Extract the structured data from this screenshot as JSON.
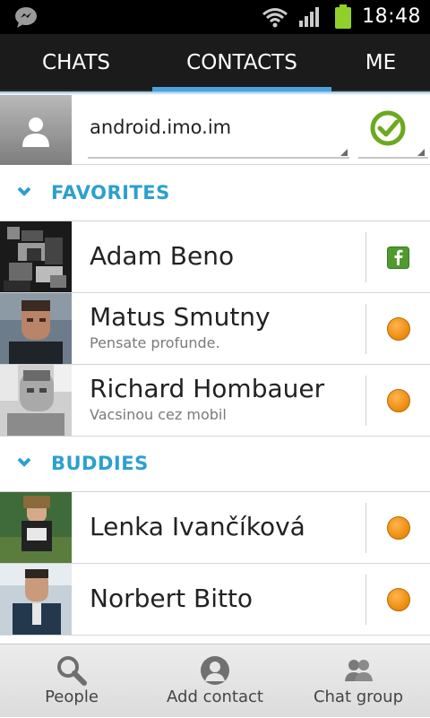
{
  "status_bar": {
    "time": "18:48",
    "icons": [
      "messenger-icon",
      "wifi-icon",
      "signal-icon",
      "battery-icon"
    ]
  },
  "tabs": [
    {
      "label": "CHATS",
      "selected": false
    },
    {
      "label": "CONTACTS",
      "selected": true
    },
    {
      "label": "ME",
      "selected": false
    }
  ],
  "account": {
    "name": "android.imo.im",
    "status": "online"
  },
  "sections": {
    "favorites": "FAVORITES",
    "buddies": "BUDDIES"
  },
  "favorites": [
    {
      "name": "Adam Beno",
      "status_text": "",
      "presence": "facebook"
    },
    {
      "name": "Matus Smutny",
      "status_text": "Pensate profunde.",
      "presence": "away"
    },
    {
      "name": "Richard Hombauer",
      "status_text": "Vacsinou cez mobil",
      "presence": "away"
    }
  ],
  "buddies": [
    {
      "name": "Lenka Ivančíková",
      "status_text": "",
      "presence": "away"
    },
    {
      "name": "Norbert Bitto",
      "status_text": "",
      "presence": "away"
    }
  ],
  "bottom_bar": {
    "people": "People",
    "add_contact": "Add contact",
    "chat_group": "Chat group"
  },
  "colors": {
    "accent": "#2ca0cf",
    "tab_underline": "#4aa3df",
    "online_green": "#6aaa1e",
    "away_orange": "#ea8a0c",
    "facebook_green": "#4f9b2e"
  }
}
